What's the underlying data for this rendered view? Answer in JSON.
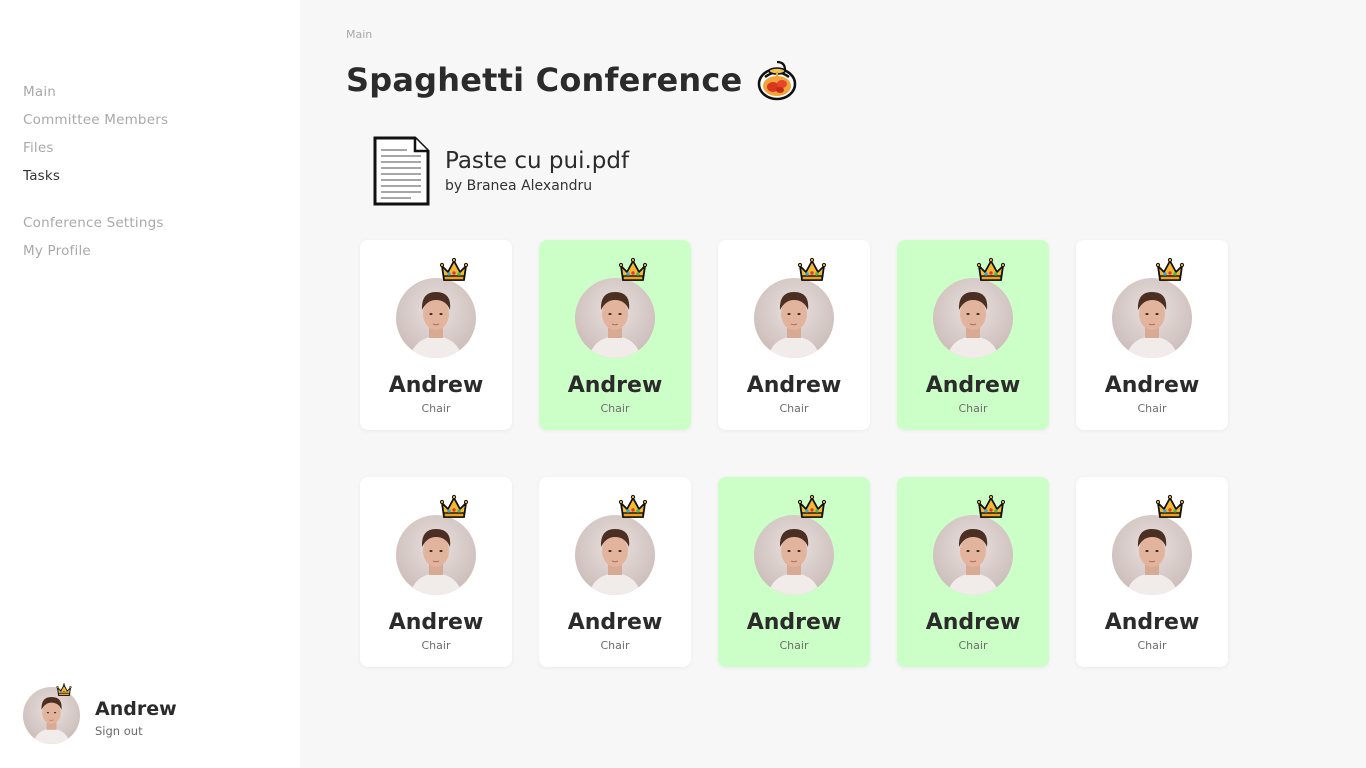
{
  "sidebar": {
    "nav_primary": [
      {
        "label": "Main",
        "active": false
      },
      {
        "label": "Committee Members",
        "active": false
      },
      {
        "label": "Files",
        "active": false
      },
      {
        "label": "Tasks",
        "active": true
      }
    ],
    "nav_secondary": [
      {
        "label": "Conference Settings"
      },
      {
        "label": "My Profile"
      }
    ],
    "user": {
      "name": "Andrew",
      "signout_label": "Sign out",
      "badge_icon": "crown-icon"
    }
  },
  "main": {
    "breadcrumb": "Main",
    "title": "Spaghetti Conference",
    "title_icon": "spaghetti-pot-icon",
    "file": {
      "name": "Paste cu pui.pdf",
      "author": "by Branea Alexandru",
      "icon": "document-icon"
    },
    "members": [
      {
        "name": "Andrew",
        "role": "Chair",
        "highlighted": false
      },
      {
        "name": "Andrew",
        "role": "Chair",
        "highlighted": true
      },
      {
        "name": "Andrew",
        "role": "Chair",
        "highlighted": false
      },
      {
        "name": "Andrew",
        "role": "Chair",
        "highlighted": true
      },
      {
        "name": "Andrew",
        "role": "Chair",
        "highlighted": false
      },
      {
        "name": "Andrew",
        "role": "Chair",
        "highlighted": false
      },
      {
        "name": "Andrew",
        "role": "Chair",
        "highlighted": false
      },
      {
        "name": "Andrew",
        "role": "Chair",
        "highlighted": true
      },
      {
        "name": "Andrew",
        "role": "Chair",
        "highlighted": true
      },
      {
        "name": "Andrew",
        "role": "Chair",
        "highlighted": false
      }
    ]
  },
  "colors": {
    "highlight": "#ccffc7",
    "card": "#ffffff",
    "page_bg": "#f7f7f7",
    "sidebar_bg": "#ffffff"
  }
}
